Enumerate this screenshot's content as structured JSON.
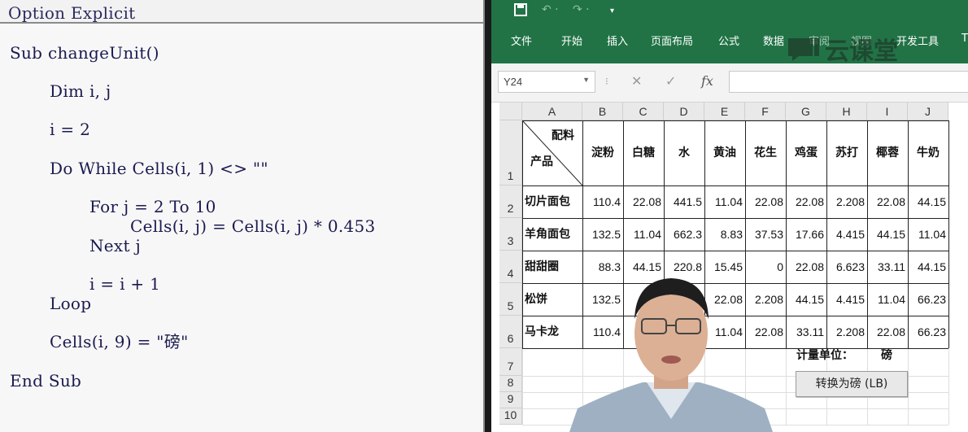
{
  "code": {
    "header": "Option Explicit",
    "lines": [
      "Sub changeUnit()",
      "Dim i, j",
      "i = 2",
      "Do While Cells(i, 1) <> \"\"",
      "For j = 2 To 10",
      "Cells(i, j) = Cells(i, j) * 0.453",
      "Next j",
      "i = i + 1",
      "Loop",
      "Cells(i, 9) = \"磅\"",
      "End Sub"
    ]
  },
  "ribbon": {
    "qat": [
      "save-icon",
      "undo-icon",
      "redo-icon",
      "customize-icon"
    ],
    "menu": [
      "文件",
      "开始",
      "插入",
      "页面布局",
      "公式",
      "数据",
      "审阅",
      "视图",
      "开发工具",
      "T"
    ],
    "watermark": "云课堂",
    "accent": "#217346"
  },
  "formula_bar": {
    "name_box": "Y24",
    "icons": [
      "cancel-icon",
      "enter-icon",
      "function-icon"
    ],
    "fx": "fx",
    "value": ""
  },
  "sheet": {
    "columns": [
      "A",
      "B",
      "C",
      "D",
      "E",
      "F",
      "G",
      "H",
      "I",
      "J"
    ],
    "rows": [
      "1",
      "2",
      "3",
      "4",
      "5",
      "6",
      "7",
      "8",
      "9",
      "10"
    ],
    "header_diag": {
      "top_right": "配料",
      "bottom_left": "产品"
    },
    "ingredients": [
      "淀粉",
      "白糖",
      "水",
      "黄油",
      "花生",
      "鸡蛋",
      "苏打",
      "椰蓉",
      "牛奶"
    ],
    "products": [
      {
        "name": "切片面包",
        "values": [
          "110.4",
          "22.08",
          "441.5",
          "11.04",
          "22.08",
          "22.08",
          "2.208",
          "22.08",
          "44.15"
        ]
      },
      {
        "name": "羊角面包",
        "values": [
          "132.5",
          "11.04",
          "662.3",
          "8.83",
          "37.53",
          "17.66",
          "4.415",
          "44.15",
          "11.04"
        ]
      },
      {
        "name": "甜甜圈",
        "values": [
          "88.3",
          "44.15",
          "220.8",
          "15.45",
          "0",
          "22.08",
          "6.623",
          "33.11",
          "44.15"
        ]
      },
      {
        "name": "松饼",
        "values": [
          "132.5",
          "4",
          "",
          "22.08",
          "2.208",
          "44.15",
          "4.415",
          "11.04",
          "66.23"
        ]
      },
      {
        "name": "马卡龙",
        "values": [
          "110.4",
          "",
          "",
          "11.04",
          "22.08",
          "33.11",
          "2.208",
          "22.08",
          "66.23"
        ]
      }
    ],
    "unit_label": "计量单位：",
    "unit_value": "磅",
    "button_label": "转换为磅 (LB)"
  }
}
